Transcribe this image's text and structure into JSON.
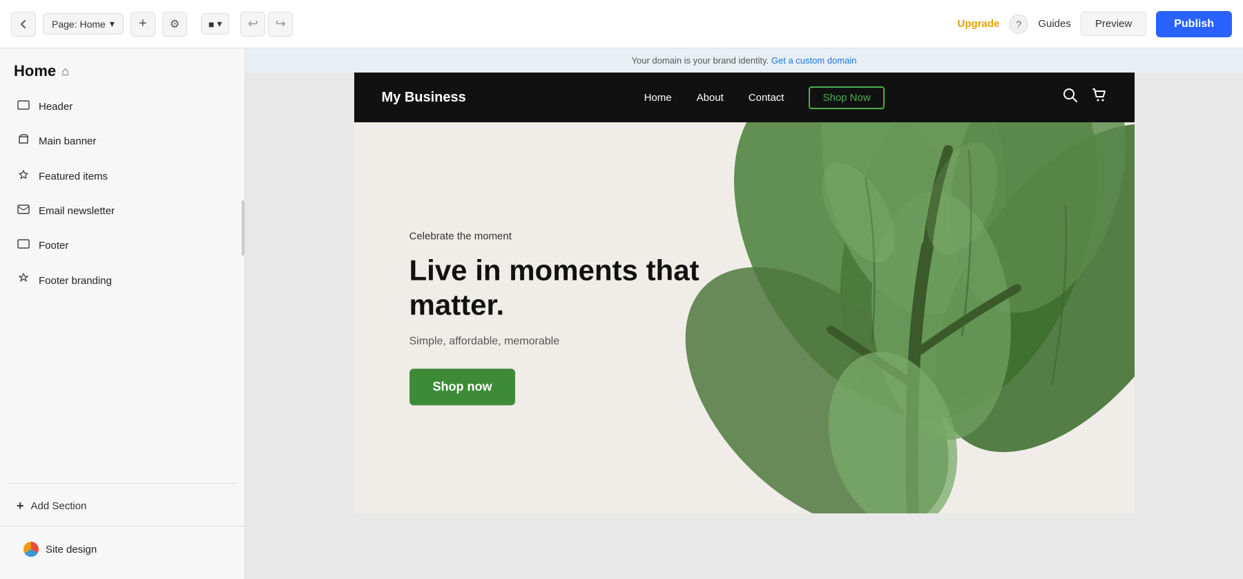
{
  "toolbar": {
    "page_label": "Page: Home",
    "chevron_down": "▾",
    "add_icon": "+",
    "settings_icon": "⚙",
    "device_icon": "■",
    "device_chevron": "▾",
    "undo_icon": "↩",
    "redo_icon": "↪",
    "upgrade_label": "Upgrade",
    "help_icon": "?",
    "guides_label": "Guides",
    "preview_label": "Preview",
    "publish_label": "Publish"
  },
  "sidebar": {
    "title": "Home",
    "home_icon": "⌂",
    "sections": [
      {
        "id": "header",
        "icon": "▭",
        "label": "Header"
      },
      {
        "id": "main-banner",
        "icon": "🏷",
        "label": "Main banner"
      },
      {
        "id": "featured-items",
        "icon": "◆",
        "label": "Featured items"
      },
      {
        "id": "email-newsletter",
        "icon": "✉",
        "label": "Email newsletter"
      },
      {
        "id": "footer",
        "icon": "▭",
        "label": "Footer"
      },
      {
        "id": "footer-branding",
        "icon": "⚡",
        "label": "Footer branding"
      }
    ],
    "add_section_icon": "+",
    "add_section_label": "Add Section",
    "site_design_label": "Site design"
  },
  "domain_banner": {
    "text": "Your domain is your brand identity.",
    "link_text": "Get a custom domain"
  },
  "site_header": {
    "logo": "My Business",
    "nav_items": [
      "Home",
      "About",
      "Contact"
    ],
    "shop_now_label": "Shop Now",
    "search_icon": "🔍",
    "cart_icon": "🛒"
  },
  "hero": {
    "tagline": "Celebrate the moment",
    "title": "Live in moments that matter.",
    "subtitle": "Simple, affordable, memorable",
    "cta_label": "Shop now"
  }
}
